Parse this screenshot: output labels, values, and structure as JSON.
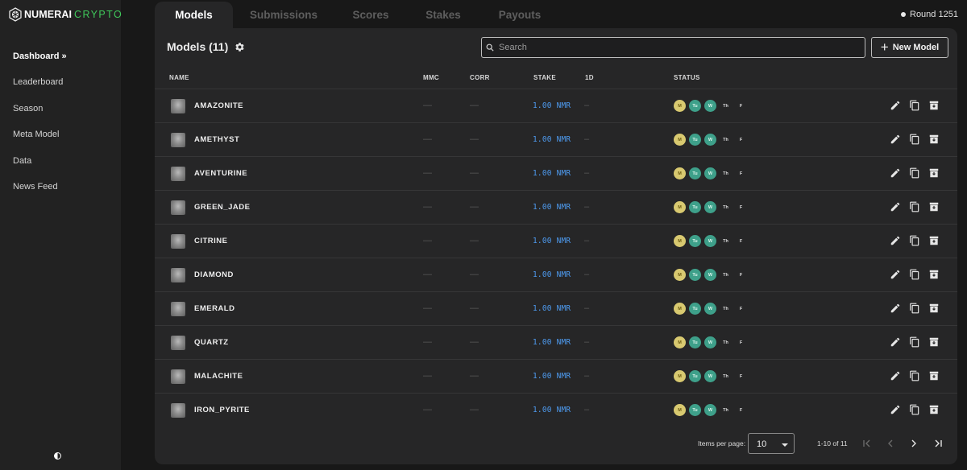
{
  "brand": {
    "name_bold": "NUMERAI",
    "name_light": "CRYPTO",
    "accent": "#3fc85a"
  },
  "sidebar": {
    "items": [
      {
        "label": "Dashboard »",
        "active": true
      },
      {
        "label": "Leaderboard"
      },
      {
        "label": "Season"
      },
      {
        "label": "Meta Model"
      },
      {
        "label": "Data"
      },
      {
        "label": "News Feed"
      }
    ],
    "theme_toggle_icon": "contrast-icon"
  },
  "tabs": [
    {
      "label": "Models",
      "active": true
    },
    {
      "label": "Submissions"
    },
    {
      "label": "Scores"
    },
    {
      "label": "Stakes"
    },
    {
      "label": "Payouts"
    }
  ],
  "round": {
    "label": "Round 1251"
  },
  "models": {
    "title": "Models (11)",
    "search_placeholder": "Search",
    "new_button": "New Model",
    "columns": {
      "name": "NAME",
      "mmc": "MMC",
      "corr": "CORR",
      "stake": "STAKE",
      "oned": "1D",
      "status": "STATUS"
    },
    "status_days": [
      "M",
      "Tu",
      "W",
      "Th",
      "F"
    ],
    "status_colors": {
      "M": "#d8c970",
      "Tu": "#3ea08a",
      "W": "#3ea08a"
    },
    "rows": [
      {
        "name": "AMAZONITE",
        "mmc": "—",
        "corr": "—",
        "stake": "1.00 NMR",
        "oned": "–"
      },
      {
        "name": "AMETHYST",
        "mmc": "—",
        "corr": "—",
        "stake": "1.00 NMR",
        "oned": "–"
      },
      {
        "name": "AVENTURINE",
        "mmc": "—",
        "corr": "—",
        "stake": "1.00 NMR",
        "oned": "–"
      },
      {
        "name": "GREEN_JADE",
        "mmc": "—",
        "corr": "—",
        "stake": "1.00 NMR",
        "oned": "–"
      },
      {
        "name": "CITRINE",
        "mmc": "—",
        "corr": "—",
        "stake": "1.00 NMR",
        "oned": "–"
      },
      {
        "name": "DIAMOND",
        "mmc": "—",
        "corr": "—",
        "stake": "1.00 NMR",
        "oned": "–"
      },
      {
        "name": "EMERALD",
        "mmc": "—",
        "corr": "—",
        "stake": "1.00 NMR",
        "oned": "–"
      },
      {
        "name": "QUARTZ",
        "mmc": "—",
        "corr": "—",
        "stake": "1.00 NMR",
        "oned": "–"
      },
      {
        "name": "MALACHITE",
        "mmc": "—",
        "corr": "—",
        "stake": "1.00 NMR",
        "oned": "–"
      },
      {
        "name": "IRON_PYRITE",
        "mmc": "—",
        "corr": "—",
        "stake": "1.00 NMR",
        "oned": "–"
      }
    ]
  },
  "pagination": {
    "items_per_page_label": "Items per page:",
    "items_per_page": "10",
    "range": "1-10 of 11"
  }
}
